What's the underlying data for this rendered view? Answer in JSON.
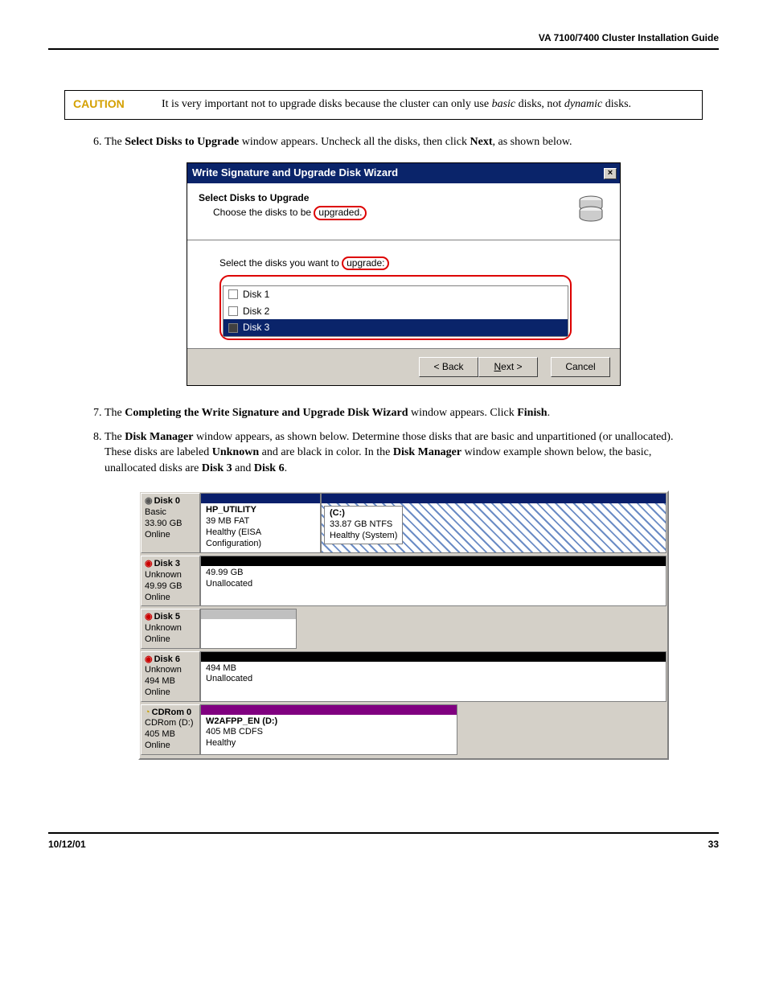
{
  "header": {
    "title": "VA 7100/7400 Cluster Installation Guide"
  },
  "caution": {
    "label": "CAUTION",
    "pre": "It is very important not to upgrade disks because the cluster can only use ",
    "basic": "basic",
    "mid": " disks, not ",
    "dynamic": "dynamic",
    "post": " disks."
  },
  "step6": {
    "a": "The ",
    "b": "Select Disks to Upgrade",
    "c": " window appears.  Uncheck all the disks, then click ",
    "d": "Next",
    "e": ", as shown below."
  },
  "wizard": {
    "title": "Write Signature and Upgrade Disk Wizard",
    "close": "×",
    "heading": "Select Disks to Upgrade",
    "sub_pre": "Choose the disks to be ",
    "sub_annot": "upgraded.",
    "body_pre": "Select the disks you want to ",
    "body_annot": "upgrade:",
    "disks": {
      "d1": "Disk 1",
      "d2": "Disk 2",
      "d3": "Disk 3"
    },
    "buttons": {
      "back": "< Back",
      "next": "Next >",
      "cancel": "Cancel"
    }
  },
  "step7": {
    "a": "The ",
    "b": "Completing the Write Signature and Upgrade Disk Wizard",
    "c": " window appears.  Click ",
    "d": "Finish",
    "e": "."
  },
  "step8": {
    "a": "The ",
    "b": "Disk Manager",
    "c": " window appears, as shown below.  Determine those disks that are basic and unpartitioned (or unallocated).  These disks are labeled ",
    "d": "Unknown",
    "e": " and are black in color.  In the ",
    "f": "Disk Manager",
    "g": " window example shown below, the basic, unallocated disks are ",
    "h": "Disk 3",
    "i": " and ",
    "j": "Disk 6",
    "k": "."
  },
  "dm": {
    "r0": {
      "name": "Disk 0",
      "type": "Basic",
      "size": "33.90 GB",
      "status": "Online",
      "v1": {
        "name": "HP_UTILITY",
        "size": "39 MB FAT",
        "stat": "Healthy (EISA Configuration)"
      },
      "v2": {
        "name": "(C:)",
        "size": "33.87 GB NTFS",
        "stat": "Healthy (System)"
      }
    },
    "r3": {
      "name": "Disk 3",
      "type": "Unknown",
      "size": "49.99 GB",
      "status": "Online",
      "v1": {
        "size": "49.99 GB",
        "stat": "Unallocated"
      }
    },
    "r5": {
      "name": "Disk 5",
      "type": "Unknown",
      "size": "",
      "status": "Online"
    },
    "r6": {
      "name": "Disk 6",
      "type": "Unknown",
      "size": "494 MB",
      "status": "Online",
      "v1": {
        "size": "494 MB",
        "stat": "Unallocated"
      }
    },
    "rcd": {
      "name": "CDRom 0",
      "type": "CDRom (D:)",
      "size": "405 MB",
      "status": "Online",
      "v1": {
        "name": "W2AFPP_EN (D:)",
        "size": "405 MB CDFS",
        "stat": "Healthy"
      }
    }
  },
  "footer": {
    "date": "10/12/01",
    "page": "33"
  }
}
